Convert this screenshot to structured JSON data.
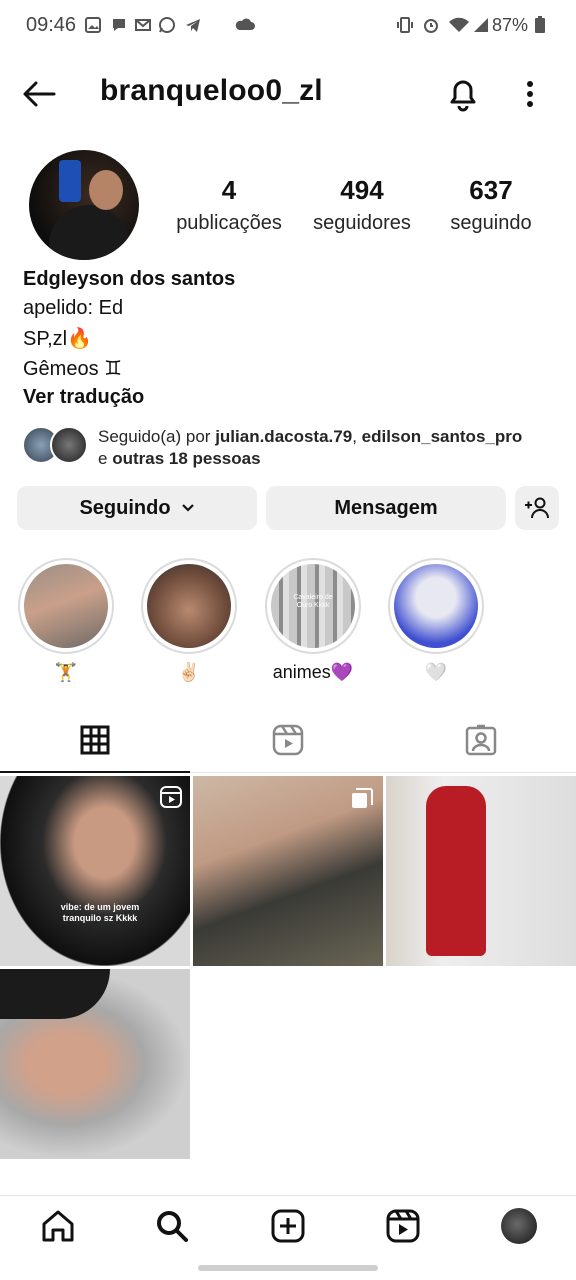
{
  "status_bar": {
    "time": "09:46",
    "battery": "87%"
  },
  "header": {
    "username": "branqueloo0_zl"
  },
  "profile": {
    "stats": [
      {
        "value": "4",
        "label": "publicações"
      },
      {
        "value": "494",
        "label": "seguidores"
      },
      {
        "value": "637",
        "label": "seguindo"
      }
    ],
    "name": "Edgleyson dos santos",
    "bio_lines": [
      "apelido: Ed",
      "SP,zl🔥",
      "Gêmeos ♊"
    ],
    "translate_link": "Ver tradução",
    "followed_by": {
      "prefix": "Seguido(a) por ",
      "user1": "julian.dacosta.79",
      "sep": ", ",
      "user2": "edilson_santos_pro",
      "and": "e ",
      "others": "outras 18 pessoas"
    }
  },
  "actions": {
    "following_label": "Seguindo",
    "message_label": "Mensagem"
  },
  "highlights": [
    {
      "caption": "🏋️"
    },
    {
      "caption": "✌🏻"
    },
    {
      "caption": "animes💜"
    },
    {
      "caption": "🤍"
    }
  ],
  "posts": [
    {
      "overlay_text": "vibe: de um jovem tranquilo sz Kkkk",
      "type": "reel"
    },
    {
      "overlay_text": "",
      "type": "carousel"
    },
    {
      "overlay_text": "",
      "type": "photo"
    },
    {
      "overlay_text": "",
      "type": "photo"
    }
  ],
  "highlight_inner_text": "Cavaleiro de Ouro Kkkk",
  "colors": {
    "accent_text": "#111111",
    "button_bg": "#efefef",
    "border": "#dbdbdb"
  }
}
